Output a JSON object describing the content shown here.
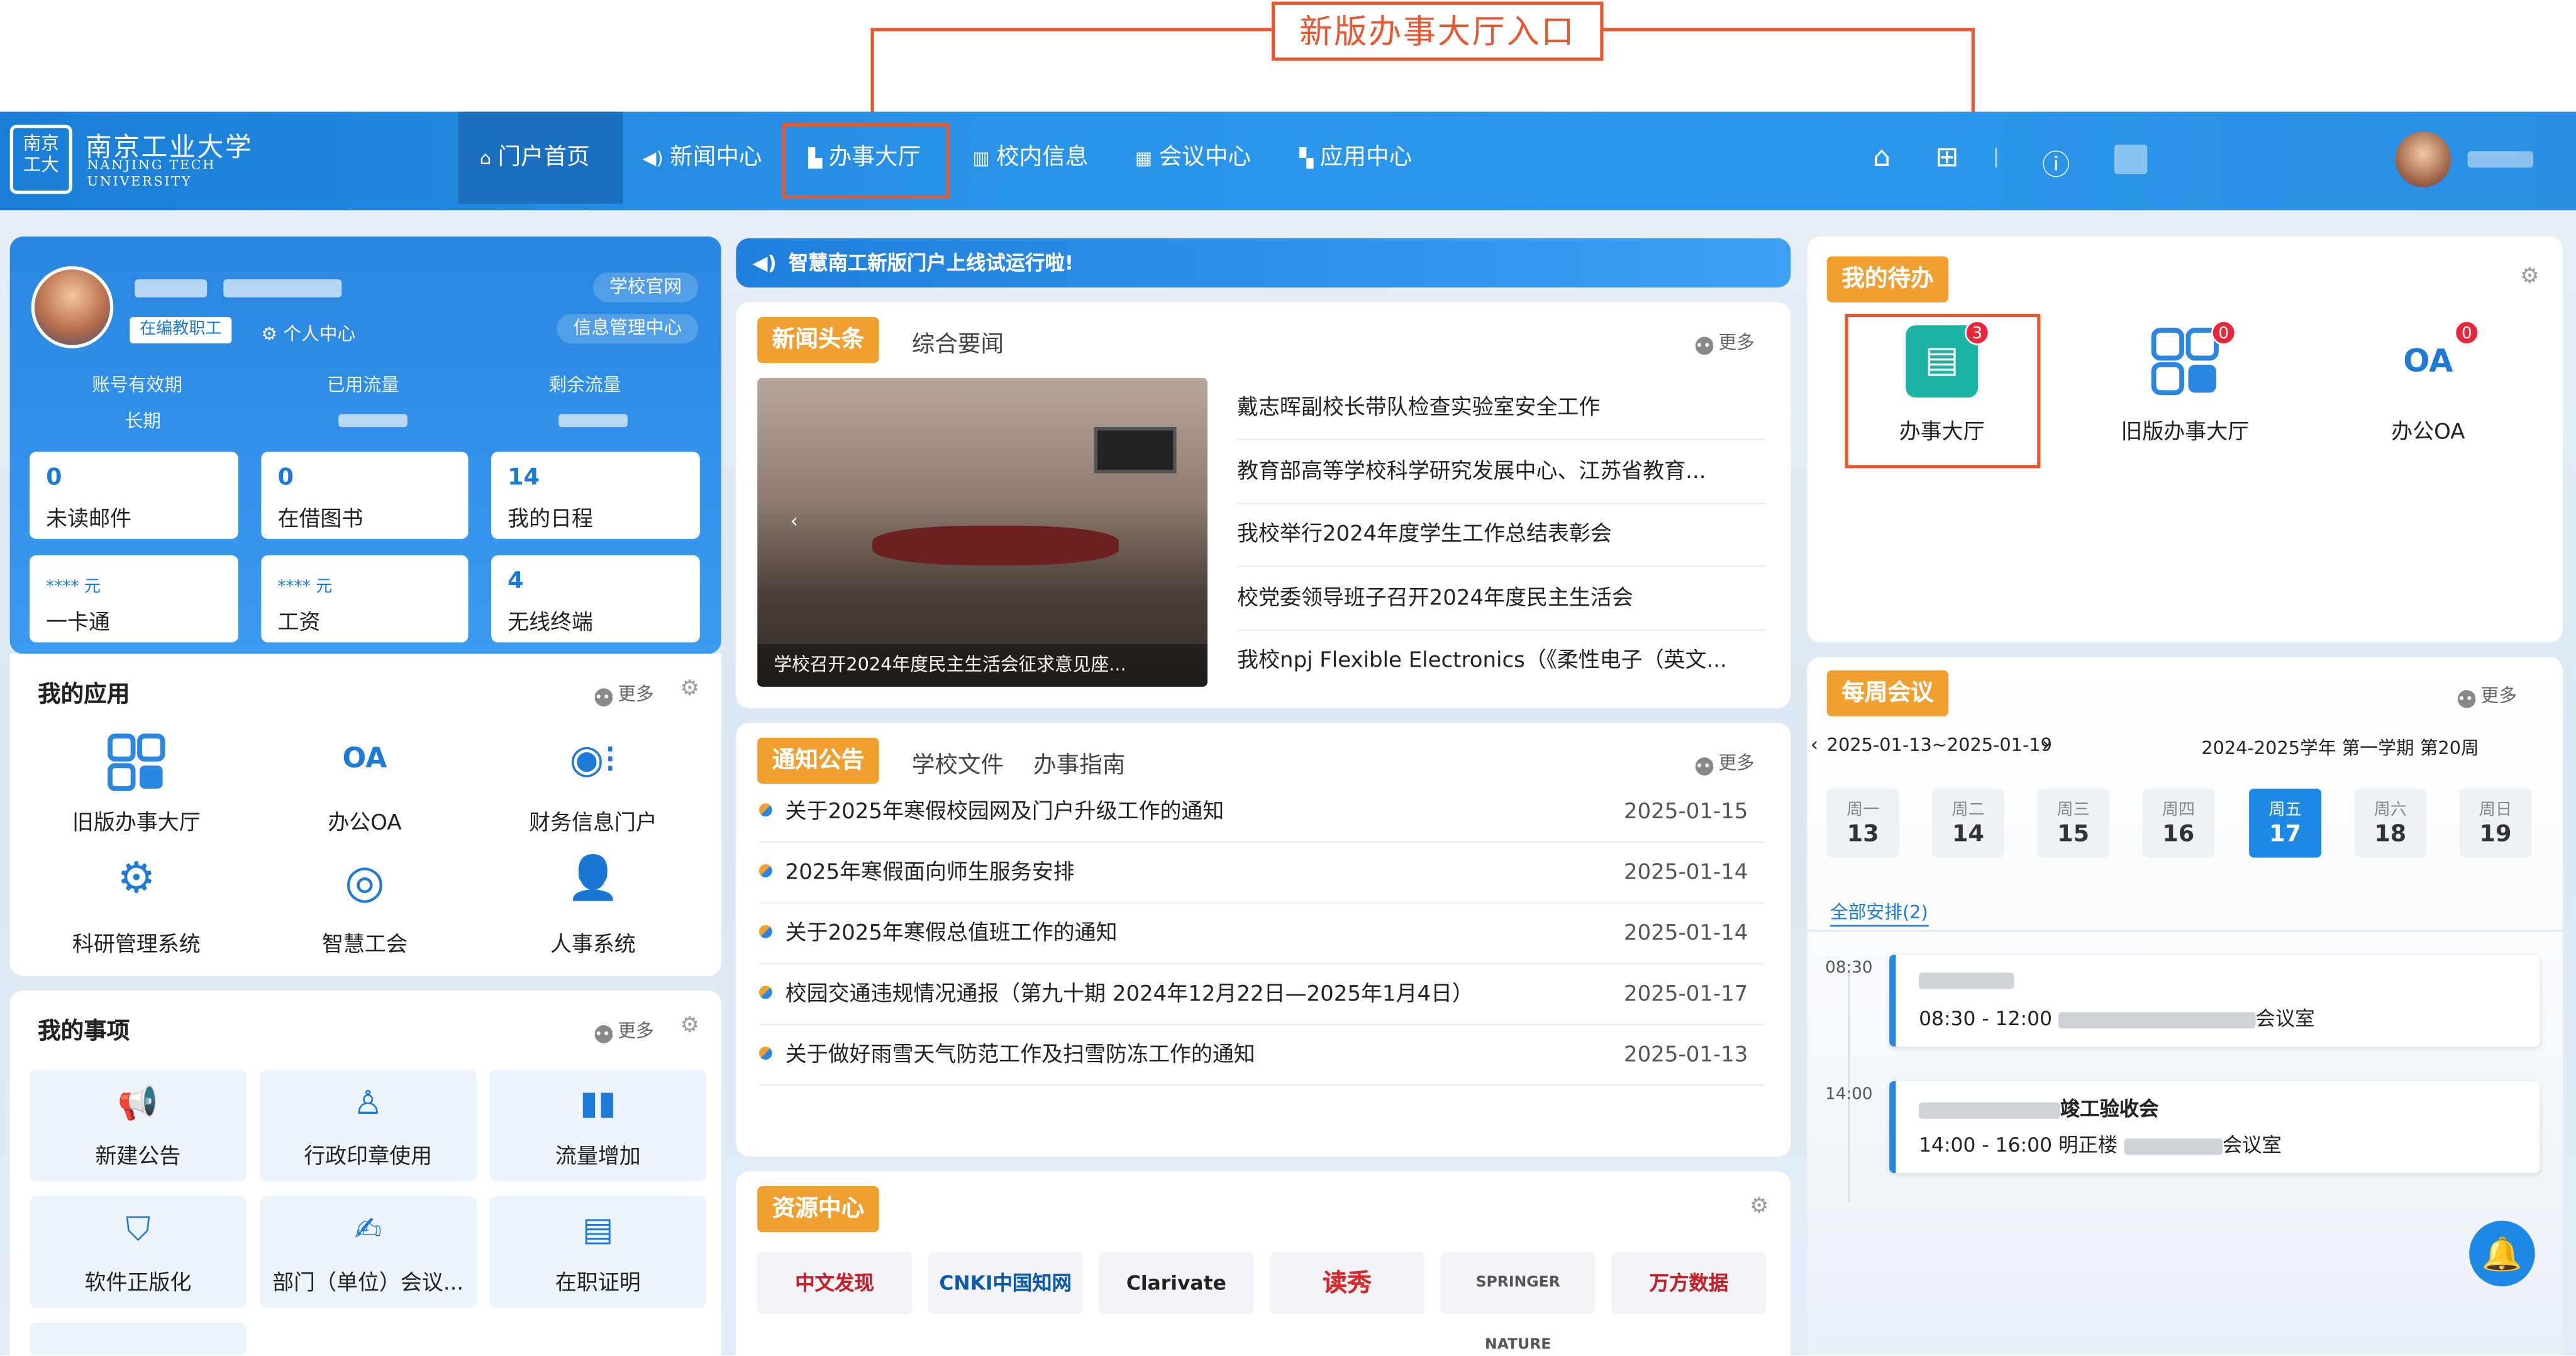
{
  "annotation": {
    "label": "新版办事大厅入口"
  },
  "header": {
    "logo": {
      "seal": "南京工业大学",
      "name_cn": "南京工业大学",
      "name_en_1": "NANJING TECH",
      "name_en_2": "UNIVERSITY"
    },
    "nav": [
      {
        "label": "门户首页",
        "icon": "home-icon"
      },
      {
        "label": "新闻中心",
        "icon": "speaker-icon"
      },
      {
        "label": "办事大厅",
        "icon": "bag-icon"
      },
      {
        "label": "校内信息",
        "icon": "building-icon"
      },
      {
        "label": "会议中心",
        "icon": "grid-icon"
      },
      {
        "label": "应用中心",
        "icon": "apps-icon"
      }
    ],
    "active_nav": "门户首页"
  },
  "profile": {
    "role": "在编教职工",
    "personal_center": "个人中心",
    "links": [
      "学校官网",
      "信息管理中心"
    ],
    "stat_headers": [
      "账号有效期",
      "已用流量",
      "剩余流量"
    ],
    "account_validity": "长期",
    "cards": [
      {
        "num": "0",
        "label": "未读邮件"
      },
      {
        "num": "0",
        "label": "在借图书"
      },
      {
        "num": "14",
        "label": "我的日程"
      },
      {
        "num": "**** 元",
        "label": "一卡通"
      },
      {
        "num": "**** 元",
        "label": "工资"
      },
      {
        "num": "4",
        "label": "无线终端"
      }
    ]
  },
  "my_apps": {
    "title": "我的应用",
    "more": "更多",
    "items": [
      "旧版办事大厅",
      "办公OA",
      "财务信息门户",
      "科研管理系统",
      "智慧工会",
      "人事系统"
    ]
  },
  "my_items": {
    "title": "我的事项",
    "more": "更多",
    "items": [
      "新建公告",
      "行政印章使用",
      "流量增加",
      "软件正版化",
      "部门（单位）会议...",
      "在职证明"
    ]
  },
  "marquee": "智慧南工新版门户上线试运行啦!",
  "news": {
    "tabs": [
      "新闻头条",
      "综合要闻"
    ],
    "more": "更多",
    "caption": "学校召开2024年度民主生活会征求意见座...",
    "items": [
      "戴志晖副校长带队检查实验室安全工作",
      "教育部高等学校科学研究发展中心、江苏省教育...",
      "我校举行2024年度学生工作总结表彰会",
      "校党委领导班子召开2024年度民主生活会",
      "我校npj Flexible Electronics（《柔性电子（英文..."
    ]
  },
  "notices": {
    "tabs": [
      "通知公告",
      "学校文件",
      "办事指南"
    ],
    "more": "更多",
    "items": [
      {
        "title": "关于2025年寒假校园网及门户升级工作的通知",
        "date": "2025-01-15"
      },
      {
        "title": "2025年寒假面向师生服务安排",
        "date": "2025-01-14"
      },
      {
        "title": "关于2025年寒假总值班工作的通知",
        "date": "2025-01-14"
      },
      {
        "title": "校园交通违规情况通报（第九十期 2024年12月22日—2025年1月4日）",
        "date": "2025-01-17"
      },
      {
        "title": "关于做好雨雪天气防范工作及扫雪防冻工作的通知",
        "date": "2025-01-13"
      }
    ]
  },
  "resources": {
    "title": "资源中心",
    "items": [
      "中文发现",
      "CNKI中国知网",
      "Clarivate",
      "读秀",
      "SPRINGER NATURE",
      "万方数据"
    ]
  },
  "todo": {
    "title": "我的待办",
    "items": [
      {
        "label": "办事大厅",
        "badge": "3"
      },
      {
        "label": "旧版办事大厅",
        "badge": "0"
      },
      {
        "label": "办公OA",
        "badge": "0"
      }
    ]
  },
  "meetings": {
    "title": "每周会议",
    "more": "更多",
    "week_range": "2025-01-13~2025-01-19",
    "term": "2024-2025学年 第一学期 第20周",
    "days": [
      {
        "w": "周一",
        "d": "13"
      },
      {
        "w": "周二",
        "d": "14"
      },
      {
        "w": "周三",
        "d": "15"
      },
      {
        "w": "周四",
        "d": "16"
      },
      {
        "w": "周五",
        "d": "17"
      },
      {
        "w": "周六",
        "d": "18"
      },
      {
        "w": "周日",
        "d": "19"
      }
    ],
    "active_day": "17",
    "all_label": "全部安排(2)",
    "events": [
      {
        "time": "08:30",
        "range": "08:30 - 12:00",
        "title": "",
        "place": "会议室",
        "building": ""
      },
      {
        "time": "14:00",
        "range": "14:00 - 16:00",
        "title": "竣工验收会",
        "place": "会议室",
        "building": "明正楼"
      }
    ]
  },
  "colors": {
    "primary": "#2a8fe2",
    "accent": "#f0a030",
    "annotation": "#e8582e",
    "badge": "#e8283a"
  }
}
